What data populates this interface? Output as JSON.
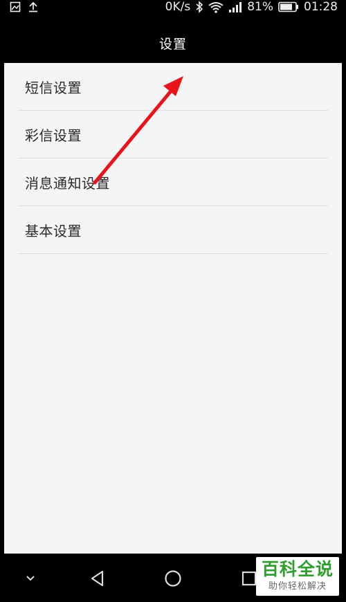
{
  "status_bar": {
    "network_speed": "0K/s",
    "battery_percent": "81%",
    "time": "01:28",
    "icons": [
      "gallery-icon",
      "upload-icon",
      "bluetooth-icon",
      "wifi-icon",
      "signal-icon",
      "battery-icon"
    ]
  },
  "header": {
    "title": "设置"
  },
  "settings": {
    "items": [
      {
        "label": "短信设置"
      },
      {
        "label": "彩信设置"
      },
      {
        "label": "消息通知设置"
      },
      {
        "label": "基本设置"
      }
    ]
  },
  "annotation": {
    "arrow_color": "#e8141c"
  },
  "nav_bar": {
    "icons": [
      "chevron-down-icon",
      "back-icon",
      "home-icon",
      "recents-icon"
    ]
  },
  "watermark": {
    "title": "百科全说",
    "subtitle": "助你轻松解决",
    "color": "#2f9e2f"
  }
}
